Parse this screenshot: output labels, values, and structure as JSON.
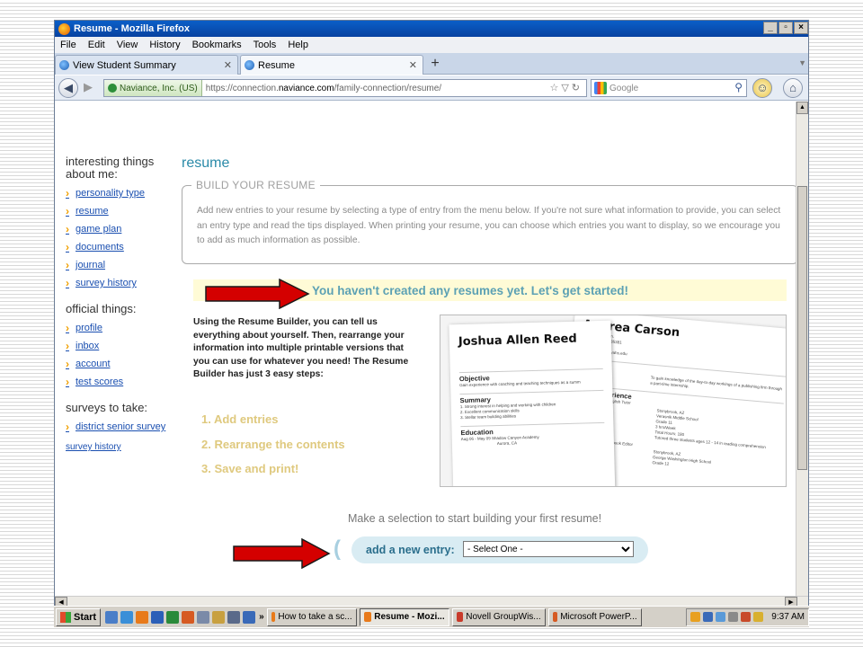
{
  "window": {
    "title": "Resume - Mozilla Firefox",
    "controls": [
      "_",
      "▫",
      "×"
    ]
  },
  "menubar": [
    "File",
    "Edit",
    "View",
    "History",
    "Bookmarks",
    "Tools",
    "Help"
  ],
  "tabs": [
    {
      "label": "View Student Summary",
      "active": false
    },
    {
      "label": "Resume",
      "active": true
    }
  ],
  "navbar": {
    "identity": "Naviance, Inc. (US)",
    "url_prefix": "https://connection.",
    "url_host": "naviance.com",
    "url_path": "/family-connection/resume/",
    "search_placeholder": "Google"
  },
  "sidebar": {
    "interesting_heading": "interesting things about me:",
    "interesting_items": [
      "personality type",
      "resume",
      "game plan",
      "documents",
      "journal",
      "survey history"
    ],
    "official_heading": "official things:",
    "official_items": [
      "profile",
      "inbox",
      "account",
      "test scores"
    ],
    "surveys_heading": "surveys to take:",
    "surveys_items": [
      "district senior survey"
    ],
    "surveys_extra_link": "survey history"
  },
  "main": {
    "heading": "resume",
    "build_legend": "BUILD YOUR RESUME",
    "build_text": "Add new entries to your resume by selecting a type of entry from the menu below. If you're not sure what information to provide, you can select an entry type and read the tips displayed. When printing your resume, you can choose which entries you want to display, so we encourage you to add as much information as possible.",
    "banner": "You haven't created any resumes yet. Let's get started!",
    "intro": "Using the Resume Builder, you can tell us everything about yourself. Then, rearrange your information into multiple printable versions that you can use for whatever you need! The Resume Builder has just 3 easy steps:",
    "steps": [
      "1.  Add entries",
      "2.  Rearrange the contents",
      "3.  Save and print!"
    ],
    "prompt": "Make a selection to start building your first resume!",
    "entry_label": "add a new entry:",
    "entry_select": "- Select One -"
  },
  "sample_resumes": {
    "front": {
      "name": "Joshua Allen Reed",
      "sections": [
        "Objective",
        "Summary",
        "Education"
      ],
      "lines": [
        "Gain experience with coaching and teaching techniques as a summ",
        "1. Strong interest in helping and working with children",
        "2. Excellent communication skills",
        "3. Stellar team building abilities",
        "Aug 06 - May 09    Shadow Canyon Academy",
        "Aurora, CA"
      ]
    },
    "back": {
      "name": "Andrea Carson",
      "contact": [
        "7718 Jasmine Ln.",
        "Stonybrook, AZ 85381",
        "623-555-7429",
        "andrea.carson@yahs.edu"
      ],
      "sections": [
        "Objective",
        "Work Experience"
      ],
      "lines": [
        "To gain knowledge of the day-to-day workings of a publishing firm through a part-time internship.",
        "Aug 07 - May 08    English Tutor",
        "Stonybrook, AZ",
        "Verasnik Middle School",
        "Grade 11",
        "3 hrs/Week",
        "Total Hours: 180",
        "Tutored three students ages 12 - 14 in reading comprehension",
        "Sep 08 - Present    Yearbook Editor",
        "Stonybrook, AZ",
        "George Washington High School",
        "Grade 12"
      ]
    }
  },
  "taskbar": {
    "start": "Start",
    "tasks": [
      {
        "label": "How to take a sc...",
        "active": false
      },
      {
        "label": "Resume - Mozi...",
        "active": true
      },
      {
        "label": "Novell GroupWis...",
        "active": false
      },
      {
        "label": "Microsoft PowerP...",
        "active": false
      }
    ],
    "clock": "9:37 AM"
  },
  "colors": {
    "accent_teal": "#2a8aa8",
    "link_blue": "#1a4fb0",
    "chevron_orange": "#f0a000",
    "banner_bg": "#fffbd6",
    "arrow_red": "#cc0000"
  }
}
